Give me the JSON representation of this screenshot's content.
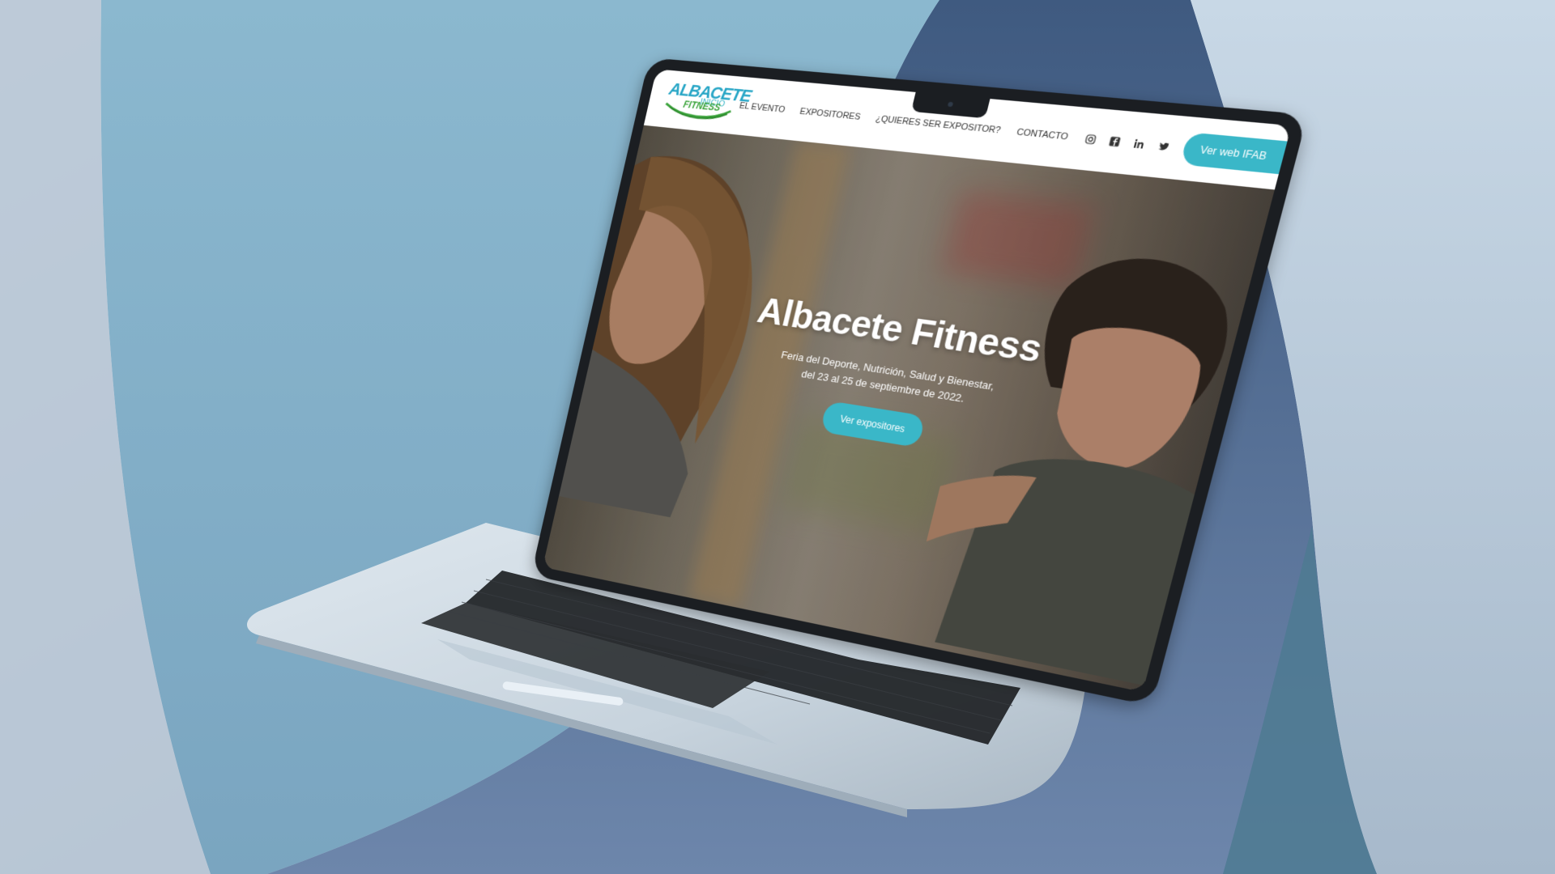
{
  "site": {
    "logo": {
      "line1": "ALBACETE",
      "line2": "FITNESS"
    },
    "nav": [
      {
        "label": "INICIO",
        "active": true
      },
      {
        "label": "EL EVENTO",
        "active": false
      },
      {
        "label": "EXPOSITORES",
        "active": false
      },
      {
        "label": "¿QUIERES SER EXPOSITOR?",
        "active": false
      },
      {
        "label": "CONTACTO",
        "active": false
      }
    ],
    "socials": [
      "instagram-icon",
      "facebook-icon",
      "linkedin-icon",
      "twitter-icon"
    ],
    "cta_top": "Ver web IFAB",
    "hero": {
      "title": "Albacete Fitness",
      "subtitle_line1": "Feria del Deporte, Nutrición, Salud y Bienestar,",
      "subtitle_line2": "del 23 al 25 de septiembre de 2022.",
      "button": "Ver expositores"
    }
  },
  "colors": {
    "accent": "#3ab7c8",
    "logo_blue": "#28a6c6",
    "logo_green": "#3aa33a"
  }
}
